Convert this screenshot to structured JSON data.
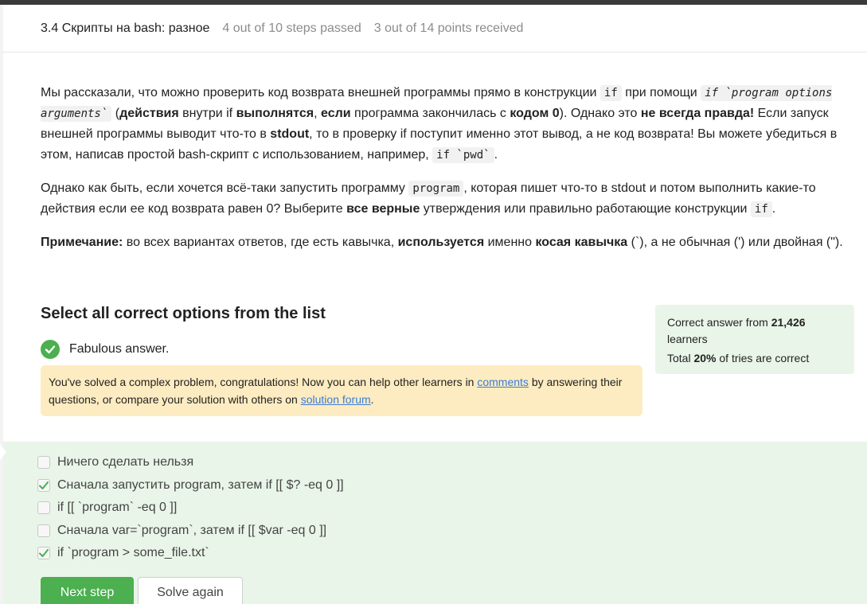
{
  "header": {
    "title": "3.4 Скрипты на bash: разное",
    "steps": "4 out of 10 steps passed",
    "points": "3 out of 14 points  received"
  },
  "content": {
    "p1_a": "Мы рассказали, что можно проверить код возврата внешней программы прямо в конструкции ",
    "p1_code1": "if",
    "p1_b": " при помощи ",
    "p1_code2": "if `program options arguments`",
    "p1_c": " (",
    "p1_bold1": "действия",
    "p1_d": " внутри if ",
    "p1_bold2": "выполнятся",
    "p1_e": ", ",
    "p1_bold3": "если",
    "p1_f": " программа закончилась с ",
    "p1_bold4": "кодом 0",
    "p1_g": "). Однако это ",
    "p1_bold5": "не всегда правда!",
    "p1_h": " Если запуск внешней программы выводит что-то в ",
    "p1_bold6": "stdout",
    "p1_i": ", то в проверку if поступит именно этот вывод, а не код возврата! Вы можете убедиться в этом, написав простой bash-скрипт с использованием, например, ",
    "p1_code3": "if `pwd`",
    "p1_j": ".",
    "p2_a": "Однако как быть, если хочется всё-таки запустить программу ",
    "p2_code1": "program",
    "p2_b": ", которая пишет что-то в stdout и потом выполнить какие-то действия если ее код возврата равен 0? Выберите ",
    "p2_bold1": "все верные",
    "p2_c": " утверждения или правильно работающие конструкции ",
    "p2_code2": "if",
    "p2_d": ".",
    "p3_bold1": "Примечание:",
    "p3_a": " во всех вариантах ответов, где есть кавычка, ",
    "p3_bold2": "используется",
    "p3_b": " именно ",
    "p3_bold3": "косая кавычка",
    "p3_c": " (`), а не обычная (') или двойная (\")."
  },
  "quiz": {
    "select_title": "Select all correct options from the list",
    "result": "Fabulous answer.",
    "note_a": "You've solved a complex problem, congratulations! Now you can help other learners in ",
    "note_link1": "comments",
    "note_b": " by answering their questions, or compare your solution with others on ",
    "note_link2": "solution forum",
    "note_c": "."
  },
  "stats": {
    "line1_a": "Correct answer from ",
    "line1_bold": "21,426",
    "line1_b": " learners",
    "line2_a": "Total ",
    "line2_bold": "20%",
    "line2_b": " of tries are correct"
  },
  "options": [
    {
      "label": "Ничего сделать нельзя",
      "checked": false
    },
    {
      "label": "Сначала запустить program, затем if [[ $? -eq 0 ]]",
      "checked": true
    },
    {
      "label": "if [[ `program` -eq 0 ]]",
      "checked": false
    },
    {
      "label": "Сначала var=`program`, затем if [[ $var -eq 0 ]]",
      "checked": false
    },
    {
      "label": "if `program > some_file.txt`",
      "checked": true
    }
  ],
  "buttons": {
    "next": "Next step",
    "again": "Solve again"
  },
  "colors": {
    "accent_green": "#4caf50",
    "options_bg": "#e9f5e9",
    "note_bg": "#fdecc1",
    "link": "#3a7bd5"
  }
}
